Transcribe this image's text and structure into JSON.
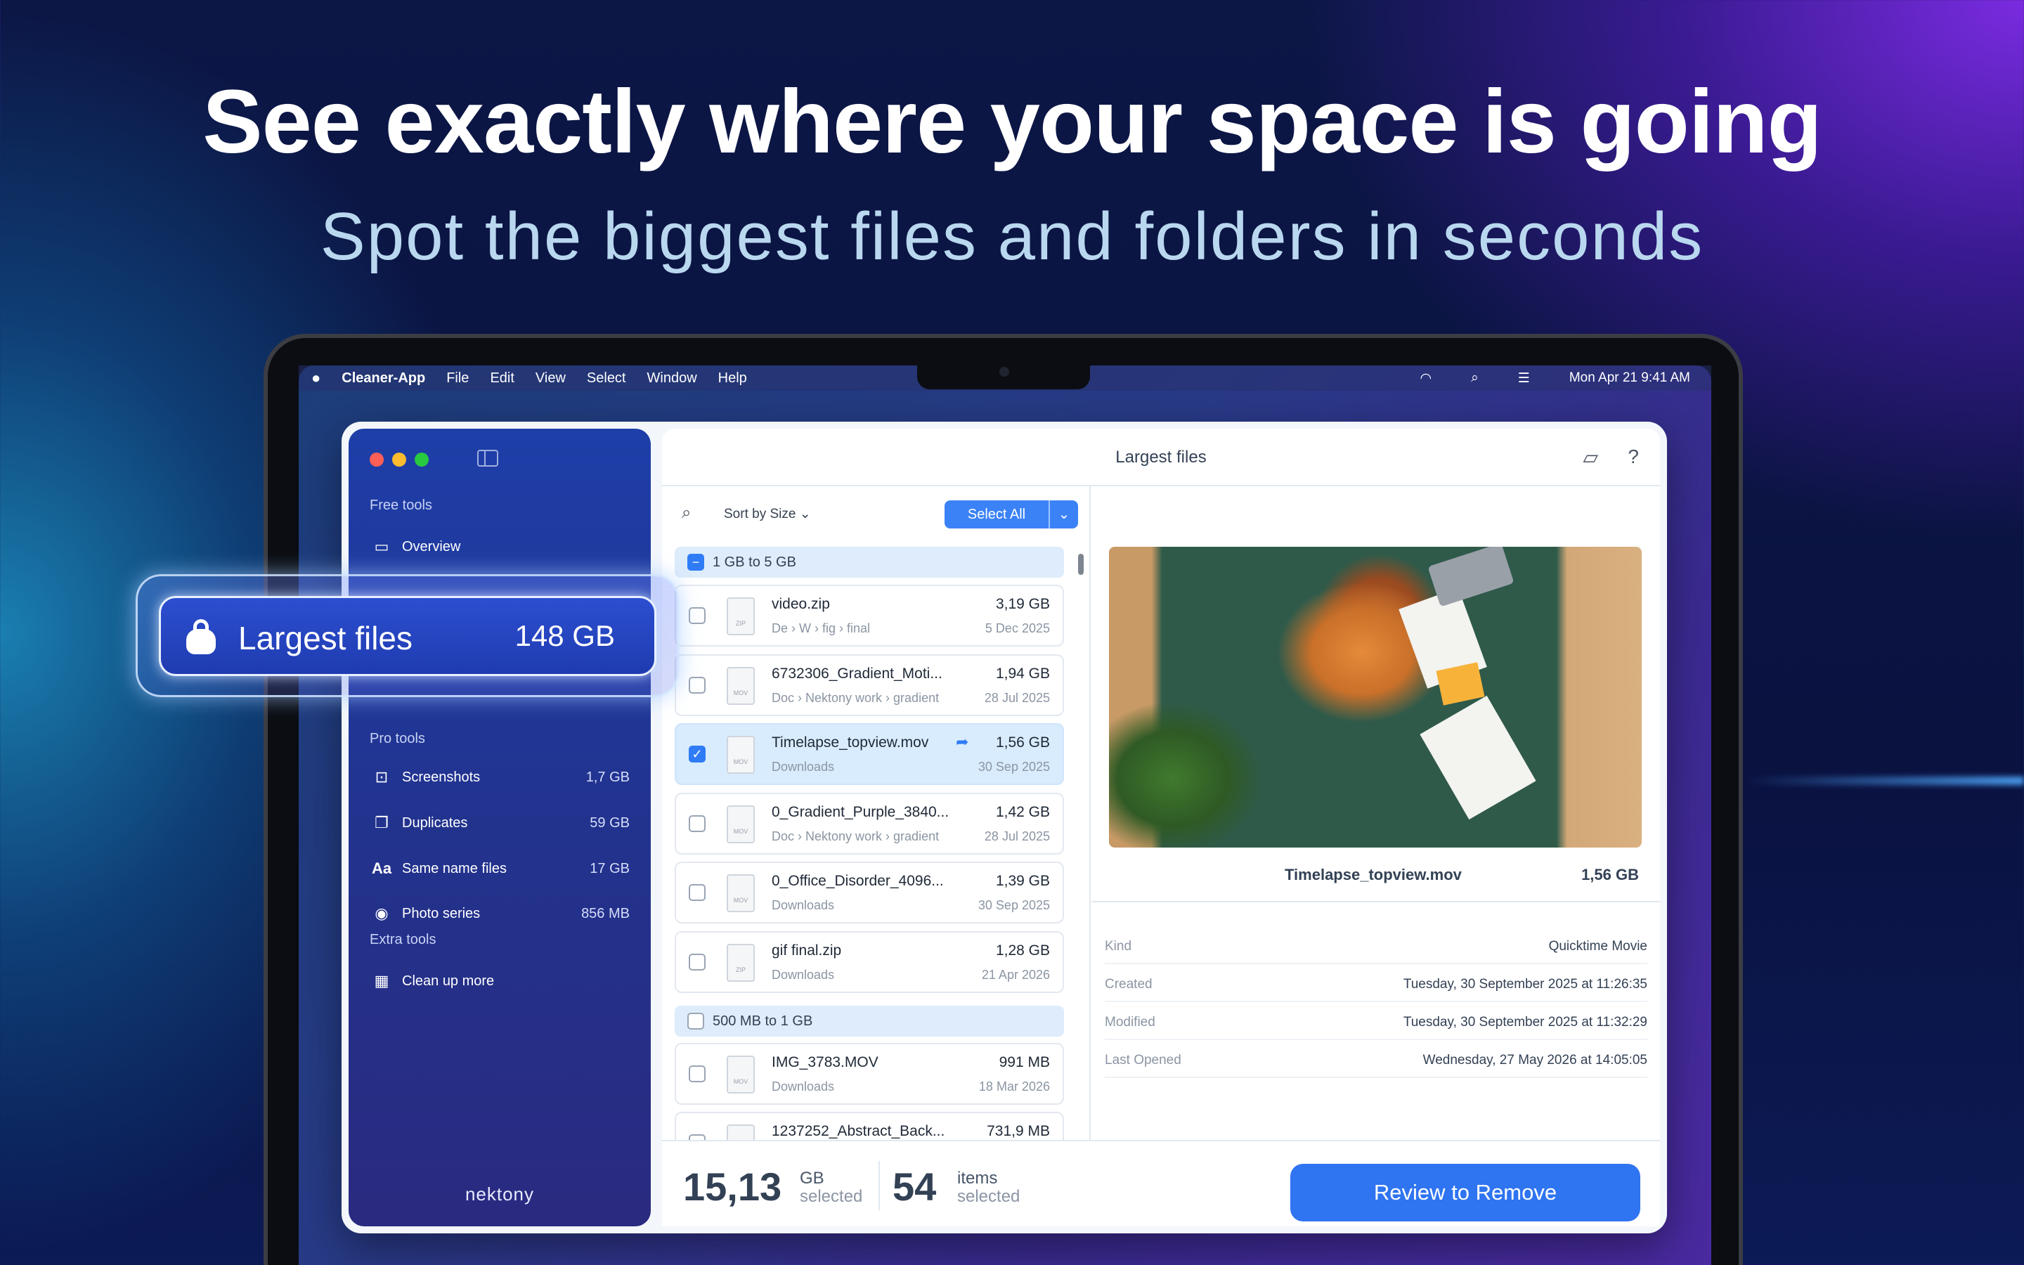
{
  "headline": "See exactly where your space is going",
  "subline": "Spot the biggest files and folders in seconds",
  "menubar": {
    "app": "Cleaner-App",
    "items": [
      "File",
      "Edit",
      "View",
      "Select",
      "Window",
      "Help"
    ],
    "clock": "Mon Apr 21  9:41 AM"
  },
  "sidebar": {
    "free_tools": "Free tools",
    "overview": "Overview",
    "pro_tools": "Pro tools",
    "pro_items": [
      {
        "label": "Screenshots",
        "size": "1,7 GB",
        "icon": "screenshot-icon"
      },
      {
        "label": "Duplicates",
        "size": "59 GB",
        "icon": "duplicates-icon"
      },
      {
        "label": "Same name files",
        "size": "17 GB",
        "icon": "font-icon"
      },
      {
        "label": "Photo series",
        "size": "856 MB",
        "icon": "camera-icon"
      }
    ],
    "extra_tools": "Extra tools",
    "clean_up": "Clean up more",
    "brand": "nektony"
  },
  "highlight": {
    "label": "Largest files",
    "size": "148 GB",
    "icon": "kettlebell-icon"
  },
  "main": {
    "title": "Largest files",
    "sort": "Sort by Size",
    "select_all": "Select All",
    "groups": [
      {
        "label": "1 GB to 5 GB"
      },
      {
        "label": "500 MB to 1 GB"
      }
    ],
    "files": [
      {
        "name": "video.zip",
        "size": "3,19 GB",
        "path": "De  ›  W  ›  fig  ›  final",
        "date": "5 Dec 2025",
        "type": "ZIP"
      },
      {
        "name": "6732306_Gradient_Moti...",
        "size": "1,94 GB",
        "path": "Doc  ›  Nektony work  ›  gradient",
        "date": "28 Jul 2025",
        "type": "MOV"
      },
      {
        "name": "Timelapse_topview.mov",
        "size": "1,56 GB",
        "path": "Downloads",
        "date": "30 Sep 2025",
        "type": "MOV"
      },
      {
        "name": "0_Gradient_Purple_3840...",
        "size": "1,42 GB",
        "path": "Doc  ›  Nektony work  ›  gradient",
        "date": "28 Jul 2025",
        "type": "MOV"
      },
      {
        "name": "0_Office_Disorder_4096...",
        "size": "1,39 GB",
        "path": "Downloads",
        "date": "30 Sep 2025",
        "type": "MOV"
      },
      {
        "name": "gif final.zip",
        "size": "1,28 GB",
        "path": "Downloads",
        "date": "21 Apr 2026",
        "type": "ZIP"
      },
      {
        "name": "IMG_3783.MOV",
        "size": "991 MB",
        "path": "Downloads",
        "date": "18 Mar 2026",
        "type": "MOV"
      },
      {
        "name": "1237252_Abstract_Back...",
        "size": "731,9 MB",
        "path": "",
        "date": "",
        "type": "MOV"
      }
    ],
    "detail": {
      "name": "Timelapse_topview.mov",
      "size": "1,56 GB",
      "props": [
        {
          "k": "Kind",
          "v": "Quicktime Movie"
        },
        {
          "k": "Created",
          "v": "Tuesday, 30 September 2025 at 11:26:35"
        },
        {
          "k": "Modified",
          "v": "Tuesday, 30 September 2025 at 11:32:29"
        },
        {
          "k": "Last Opened",
          "v": "Wednesday, 27 May 2026 at 14:05:05"
        }
      ]
    },
    "footer": {
      "size": "15,13",
      "size_unit": "GB",
      "size_sub": "selected",
      "count": "54",
      "count_unit": "items",
      "count_sub": "selected",
      "review": "Review to Remove"
    }
  }
}
